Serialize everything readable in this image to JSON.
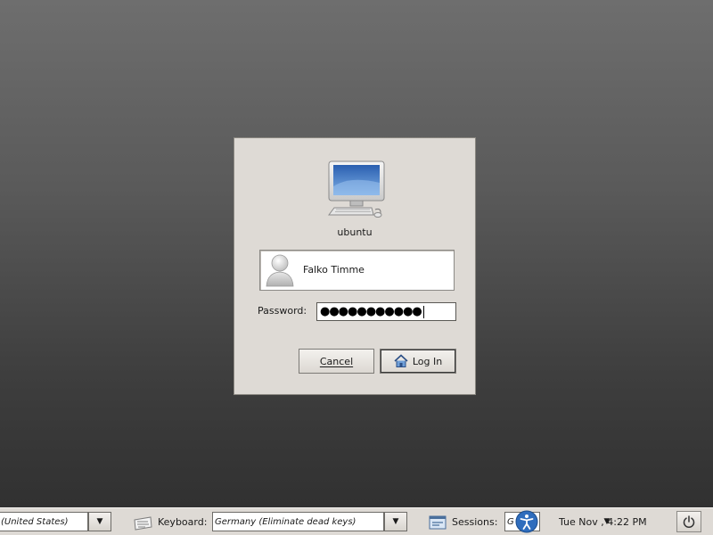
{
  "login_dialog": {
    "hostname": "ubuntu",
    "user_name": "Falko Timme",
    "password_label": "Password:",
    "password_value": "●●●●●●●●●●●",
    "cancel_label": "Cancel",
    "login_label": "Log In",
    "icons": {
      "computer": "computer-monitor-icon",
      "avatar": "user-avatar-icon",
      "login": "home-icon"
    }
  },
  "panel": {
    "language_value": "(United States)",
    "keyboard_label": "Keyboard:",
    "keyboard_value": "Germany (Eliminate dead keys)",
    "sessions_label": "Sessions:",
    "sessions_value": "G",
    "clock": "Tue Nov  , 4:22 PM",
    "icons": {
      "keyboard": "keyboard-icon",
      "sessions": "sessions-icon",
      "accessibility": "accessibility-icon",
      "power": "power-icon"
    }
  },
  "colors": {
    "dialog_bg": "#dedad5",
    "accent_blue": "#3a6ea5"
  }
}
